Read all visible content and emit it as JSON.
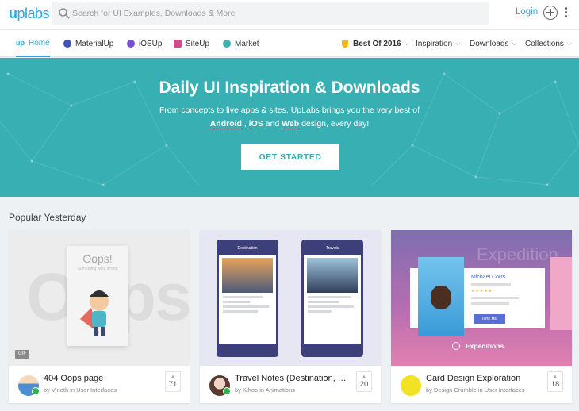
{
  "brand": {
    "logo_accent": "u",
    "logo_text": "plabs"
  },
  "search": {
    "placeholder": "Search for UI Examples, Downloads & More"
  },
  "header": {
    "login": "Login"
  },
  "nav": {
    "left": [
      {
        "label": "Home",
        "active": true,
        "icon": "uplabs-icon"
      },
      {
        "label": "MaterialUp",
        "icon": "materialup-icon",
        "color": "#3f51b5"
      },
      {
        "label": "iOSUp",
        "icon": "iosup-icon",
        "color": "#7b4fd1"
      },
      {
        "label": "SiteUp",
        "icon": "siteup-icon",
        "color": "#d64a8a"
      },
      {
        "label": "Market",
        "icon": "market-icon",
        "color": "#3fb0b2"
      }
    ],
    "right": [
      {
        "label": "Best Of 2016",
        "icon": "trophy-icon"
      },
      {
        "label": "Inspiration"
      },
      {
        "label": "Downloads"
      },
      {
        "label": "Collections"
      }
    ]
  },
  "hero": {
    "title": "Daily UI Inspiration & Downloads",
    "line1": "From concepts to live apps & sites, UpLabs brings you the very best of",
    "android": "Android",
    "sep1": " , ",
    "ios": "iOS",
    "and": " and ",
    "web": "Web",
    "tail": " design, every day!",
    "cta": "GET STARTED",
    "bg_color": "#38b0b3"
  },
  "section": {
    "title": "Popular Yesterday"
  },
  "cards": [
    {
      "title": "404 Oops page",
      "byline": "by Vinoth in User Interfaces",
      "votes": "71",
      "thumb": {
        "big": "Oops!",
        "oops": "Oops!",
        "sub": "Something went wrong",
        "badge": "GIF"
      }
    },
    {
      "title": "Travel Notes (Destination, Travels)",
      "byline": "by Kihoo in Animations",
      "votes": "20",
      "thumb": {
        "screen1": "Destination",
        "screen2": "Travels"
      }
    },
    {
      "title": "Card Design Exploration",
      "byline": "by Design Crumble in User Interfaces",
      "votes": "18",
      "thumb": {
        "watermark": "Expedition",
        "person": "Michael Corrs",
        "stars": "★★★★★",
        "button": "HIRE ME",
        "brand": "Expeditions."
      }
    }
  ]
}
